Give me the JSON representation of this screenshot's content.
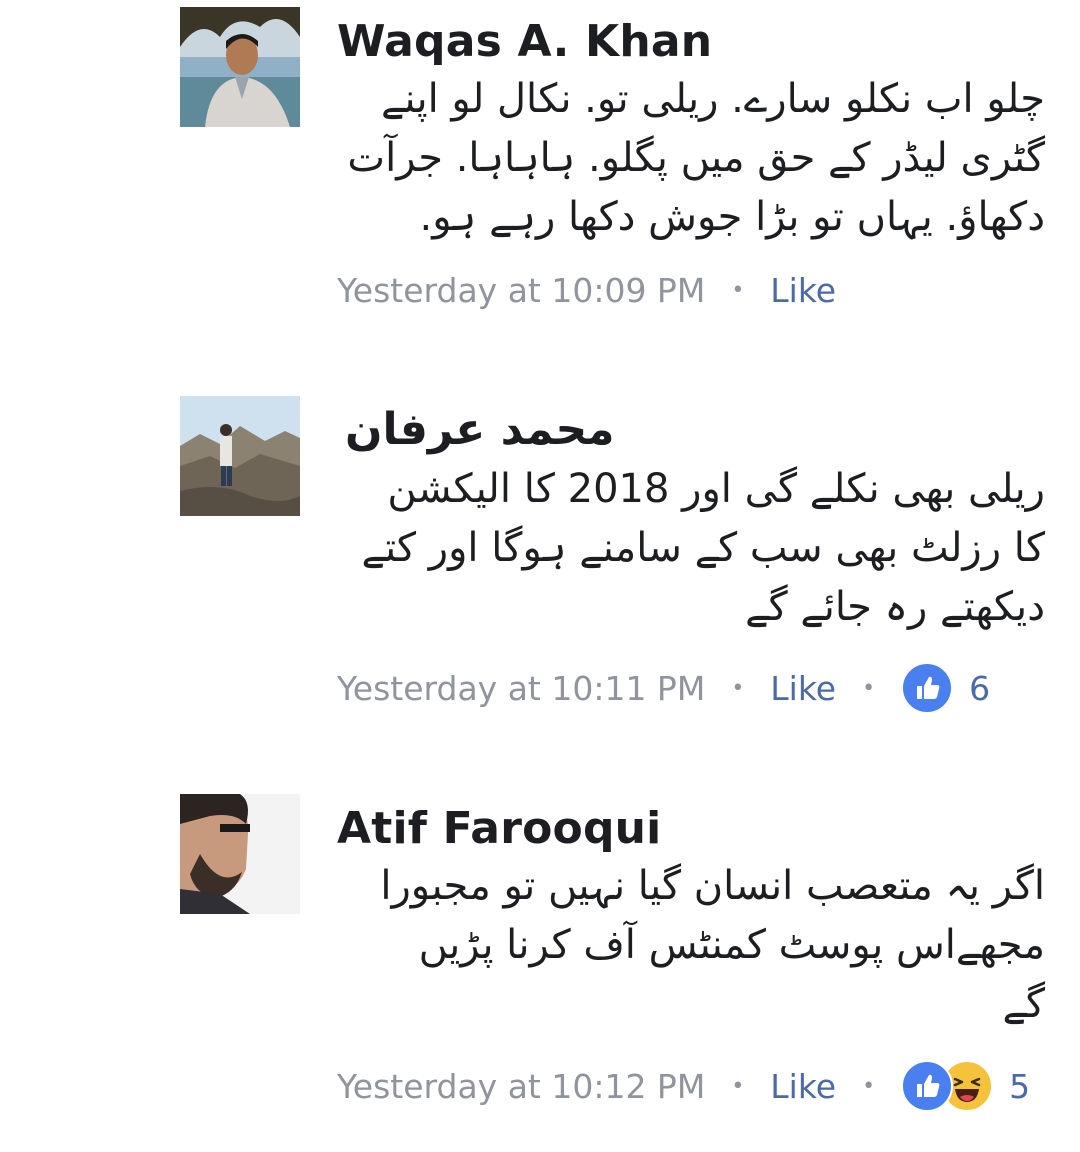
{
  "comments": [
    {
      "author": "Waqas A. Khan",
      "text_lines": [
        "چلو اب نکلو سارے. ریلی تو. نکال لو اپنے",
        "گٹری لیڈر کے حق میں پگلو. ہاہاہا. جرآت",
        "دکھاؤ. یہاں تو بڑا جوش دکھا رہے ہو."
      ],
      "timestamp": "Yesterday at 10:09 PM",
      "like_label": "Like",
      "reactions": null
    },
    {
      "author": "محمد عرفان",
      "text_lines": [
        "ریلی بھی نکلے گی اور 2018 کا الیکشن",
        "کا رزلٹ بھی سب کے سامنے ہوگا اور کتے",
        "دیکھتے رہ جائے گے"
      ],
      "timestamp": "Yesterday at 10:11 PM",
      "like_label": "Like",
      "reactions": {
        "types": [
          "like-icon"
        ],
        "count": "6"
      }
    },
    {
      "author": "Atif Farooqui",
      "text_lines": [
        "اگر یہ متعصب  انسان گیا نہیں تو مجبورا",
        "مجھےاس پوسٹ  کمنٹس آف کرنا پڑیں",
        "گے"
      ],
      "timestamp": "Yesterday at 10:12 PM",
      "like_label": "Like",
      "reactions": {
        "types": [
          "like-icon",
          "haha-icon"
        ],
        "count": "5"
      }
    }
  ],
  "colors": {
    "author": "#1c1e21",
    "meta": "#90949c",
    "link": "#4b6aa6",
    "like_reaction": "#4a7ff0",
    "haha_reaction": "#f5c33b"
  }
}
